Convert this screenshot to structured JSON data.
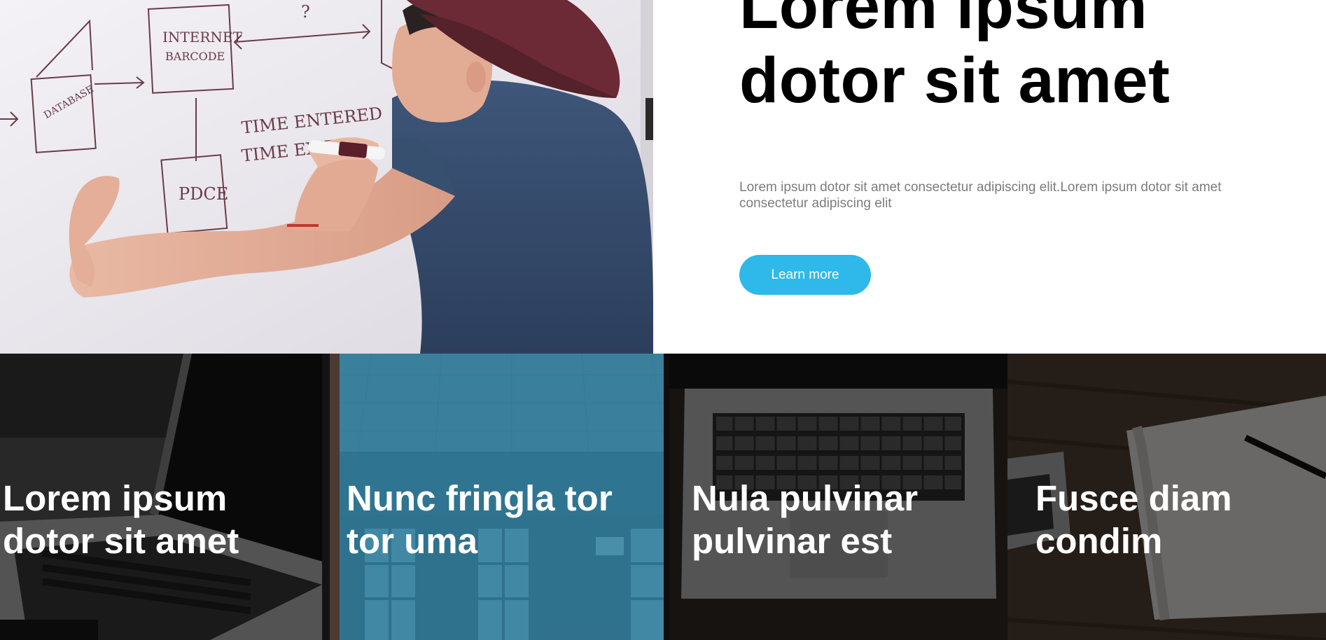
{
  "hero": {
    "title_line1": "Lorem ipsum",
    "title_line2": "dotor sit amet",
    "description": "Lorem ipsum dotor sit amet consectetur adipiscing elit.Lorem ipsum dotor sit amet consectetur adipiscing elit",
    "button_label": "Learn more",
    "button_color": "#2fb8ea",
    "photo_icon": "whiteboard-photo"
  },
  "cards": [
    {
      "title_line1": "Lorem ipsum",
      "title_line2": "dotor sit amet",
      "overlay_color": "#000000",
      "photo_icon": "laptop-photo"
    },
    {
      "title_line1": "Nunc fringla tor",
      "title_line2": "tor uma",
      "overlay_color": "#2c7c9c",
      "photo_icon": "office-windows-photo"
    },
    {
      "title_line1": "Nula pulvinar",
      "title_line2": "pulvinar est",
      "overlay_color": "#000000",
      "photo_icon": "laptop-keyboard-photo"
    },
    {
      "title_line1": "Fusce diam",
      "title_line2": "condim",
      "overlay_color": "#000000",
      "photo_icon": "notebook-pen-photo"
    }
  ]
}
